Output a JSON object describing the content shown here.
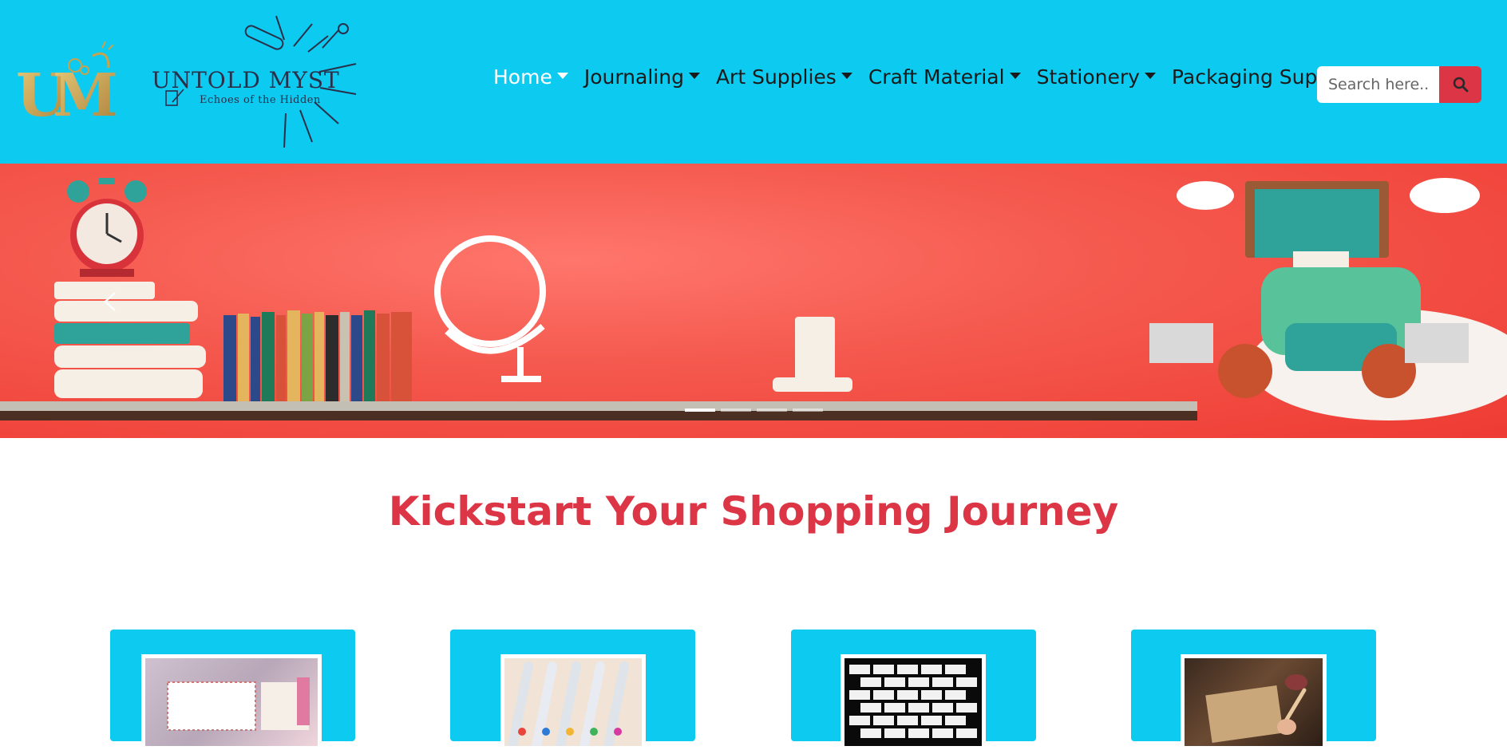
{
  "brand": {
    "name": "UNTOLD MYST",
    "tagline": "Echoes of the Hidden",
    "logo_monogram": "UM"
  },
  "nav": {
    "items": [
      {
        "label": "Home",
        "active": true
      },
      {
        "label": "Journaling",
        "active": false
      },
      {
        "label": "Art Supplies",
        "active": false
      },
      {
        "label": "Craft Material",
        "active": false
      },
      {
        "label": "Stationery",
        "active": false
      },
      {
        "label": "Packaging Supplies",
        "active": false
      }
    ]
  },
  "search": {
    "placeholder": "Search here...",
    "icon": "search-icon"
  },
  "carousel": {
    "slide_count": 4,
    "active_slide": 1,
    "prev_icon": "chevron-left-icon"
  },
  "section": {
    "title": "Kickstart Your Shopping Journey"
  },
  "colors": {
    "header_bg": "#0dcaf0",
    "accent_red": "#dc3545",
    "nav_active": "#ffffff",
    "banner_red": "#ee3b33"
  }
}
